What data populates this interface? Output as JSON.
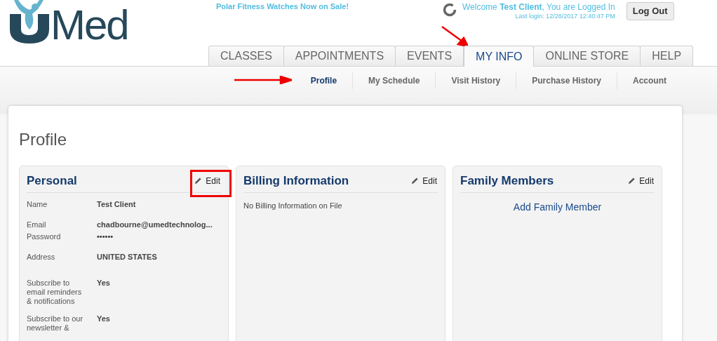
{
  "logo": {
    "text": "Med"
  },
  "promo": "Polar Fitness Watches Now on Sale!",
  "welcome": {
    "greeting": "Welcome",
    "name": "Test Client",
    "suffix": ", You are Logged In",
    "last_login": "Last login: 12/28/2017 12:40:47 PM"
  },
  "logout_button": "Log Out",
  "tabs": [
    {
      "label": "CLASSES",
      "selected": false
    },
    {
      "label": "APPOINTMENTS",
      "selected": false
    },
    {
      "label": "EVENTS",
      "selected": false
    },
    {
      "label": "MY INFO",
      "selected": true
    },
    {
      "label": "ONLINE STORE",
      "selected": false
    },
    {
      "label": "HELP",
      "selected": false
    }
  ],
  "subnav": [
    {
      "label": "Profile",
      "selected": true
    },
    {
      "label": "My Schedule",
      "selected": false
    },
    {
      "label": "Visit History",
      "selected": false
    },
    {
      "label": "Purchase History",
      "selected": false
    },
    {
      "label": "Account",
      "selected": false
    }
  ],
  "page_title": "Profile",
  "panels": [
    {
      "kind": "fields",
      "title": "Personal",
      "edit": "Edit",
      "fields": [
        {
          "label": "Name",
          "value": "Test Client"
        },
        {
          "label": "Email",
          "value": "chadbourne@umedtechnolog..."
        },
        {
          "label": "Password",
          "value": "••••••"
        },
        {
          "label": "Address",
          "value": "UNITED STATES"
        },
        {
          "label": "Subscribe to email reminders & notifications",
          "value": "Yes"
        },
        {
          "label": "Subscribe to our newsletter &",
          "value": "Yes"
        }
      ]
    },
    {
      "kind": "message",
      "title": "Billing Information",
      "edit": "Edit",
      "message": "No Billing Information on File"
    },
    {
      "kind": "link",
      "title": "Family Members",
      "edit": "Edit",
      "link": "Add Family Member"
    }
  ]
}
